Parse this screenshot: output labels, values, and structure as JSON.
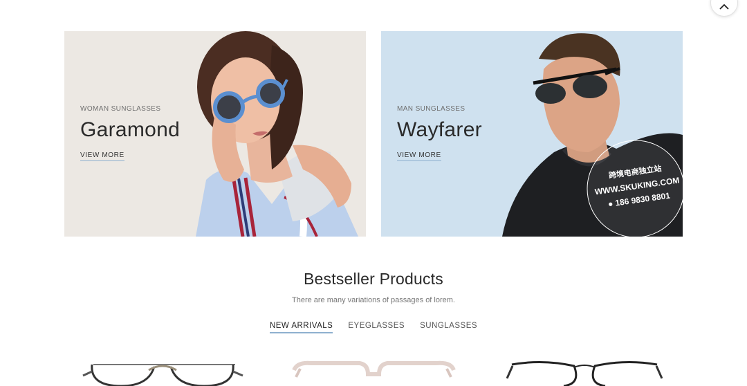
{
  "scroll_top": {
    "icon": "chevron-up-icon"
  },
  "banners": [
    {
      "eyebrow": "WOMAN SUNGLASSES",
      "title": "Garamond",
      "link": "VIEW MORE"
    },
    {
      "eyebrow": "MAN SUNGLASSES",
      "title": "Wayfarer",
      "link": "VIEW MORE"
    }
  ],
  "watermark": {
    "line1": "跨境电商独立站",
    "line2": "WWW.SKUKING.COM",
    "line3": "186 9830 8801"
  },
  "bestseller": {
    "title": "Bestseller Products",
    "subtitle": "There are many variations of passages of lorem.",
    "tabs": [
      "NEW ARRIVALS",
      "EYEGLASSES",
      "SUNGLASSES"
    ],
    "active_tab": "NEW ARRIVALS"
  },
  "colors": {
    "accent_underline": "#8fb0cf",
    "left_banner_bg": "#ece8e3",
    "right_banner_bg": "#cfe1ef"
  }
}
